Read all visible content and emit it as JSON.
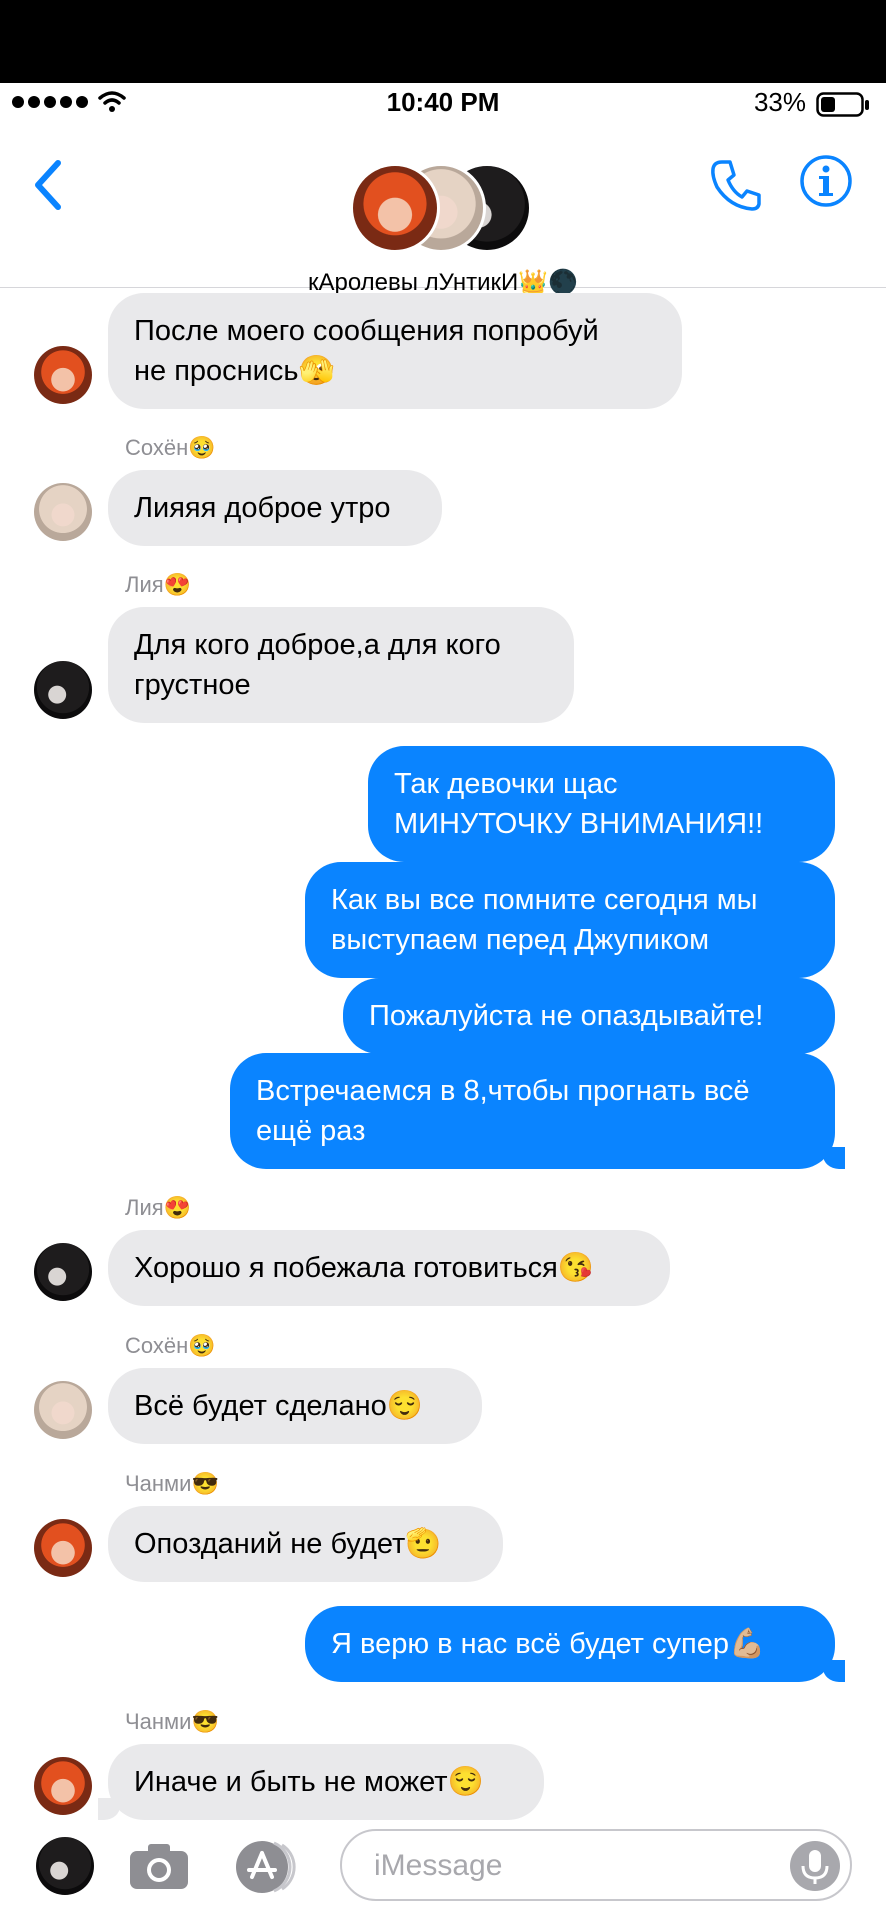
{
  "status_bar": {
    "time": "10:40 PM",
    "battery": "33%"
  },
  "header": {
    "group_name": "кАролевы лУнтикИ👑🌑",
    "icons": [
      "back-chevron-icon",
      "phone-icon",
      "info-icon"
    ]
  },
  "messages": [
    {
      "from": "in",
      "sender": "",
      "text1": "После моего сообщения попробуй",
      "text2": "не проснись🫣"
    },
    {
      "from": "in",
      "sender": "Сохён🥹",
      "text1": "Лияяя доброе утро"
    },
    {
      "from": "in",
      "sender": "Лия😍",
      "text1": "Для кого доброе,а для кого",
      "text2": "грустное"
    },
    {
      "from": "out",
      "text1": "Так девочки щас",
      "text2": "МИНУТОЧКУ ВНИМАНИЯ!!"
    },
    {
      "from": "out",
      "text1": "Как вы все помните сегодня мы",
      "text2": "выступаем перед Джупиком"
    },
    {
      "from": "out",
      "text1": "Пожалуйста не опаздывайте!"
    },
    {
      "from": "out",
      "text1": "Встречаемся в 8,чтобы прогнать всё",
      "text2": "ещё раз"
    },
    {
      "from": "in",
      "sender": "Лия😍",
      "text1": "Хорошо я побежала готовиться😘"
    },
    {
      "from": "in",
      "sender": "Сохён🥹",
      "text1": "Всё будет сделано😌"
    },
    {
      "from": "in",
      "sender": "Чанми😎",
      "text1": "Опозданий не будет🫡"
    },
    {
      "from": "out",
      "text1": "Я верю в нас всё будет супер💪🏼"
    },
    {
      "from": "in",
      "sender": "Чанми😎",
      "text1": "Иначе и быть не может😌"
    }
  ],
  "input": {
    "placeholder": "iMessage"
  },
  "colors": {
    "outgoing_bubble": "#0a84ff",
    "incoming_bubble": "#e9e9eb",
    "accent": "#0a84ff"
  }
}
